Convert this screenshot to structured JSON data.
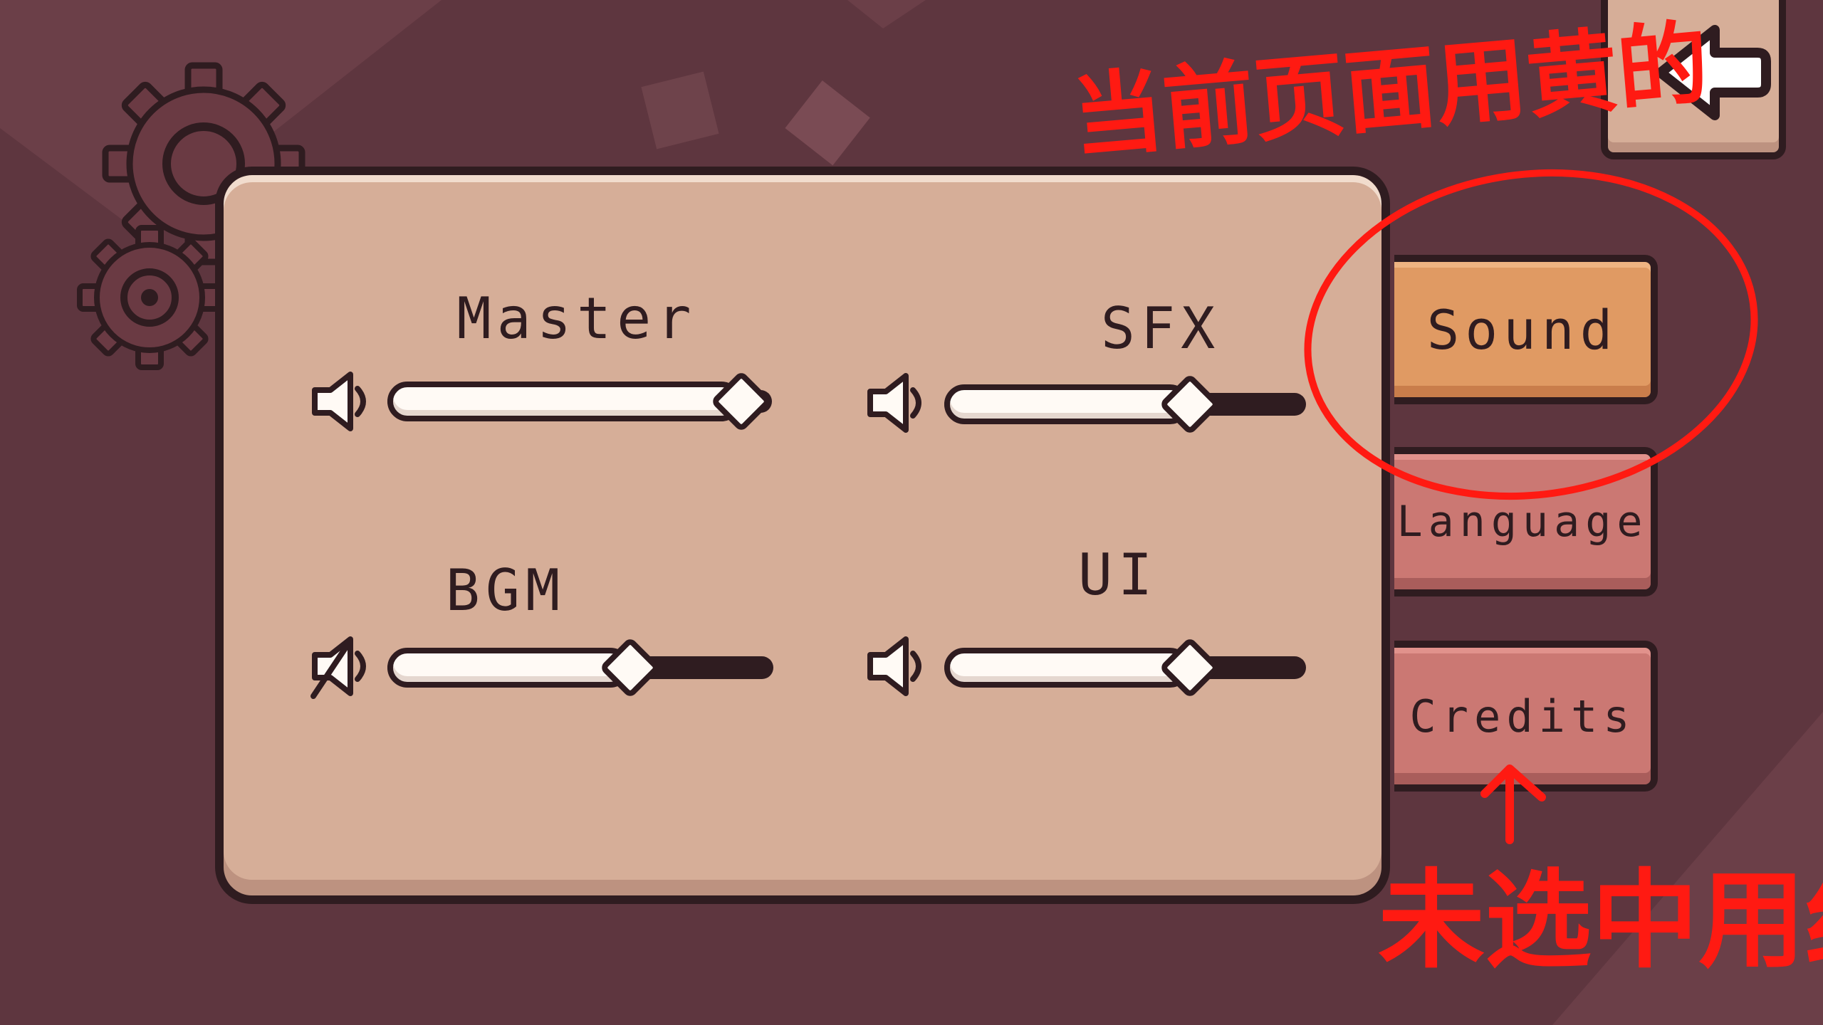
{
  "settings": {
    "sliders": [
      {
        "id": "master",
        "label": "Master",
        "value": 0.92,
        "muted": false
      },
      {
        "id": "sfx",
        "label": "SFX",
        "value": 0.68,
        "muted": false
      },
      {
        "id": "bgm",
        "label": "BGM",
        "value": 0.63,
        "muted": true
      },
      {
        "id": "ui",
        "label": "UI",
        "value": 0.68,
        "muted": false
      }
    ],
    "tabs": [
      {
        "id": "sound",
        "label": "Sound",
        "selected": true
      },
      {
        "id": "language",
        "label": "Language",
        "selected": false
      },
      {
        "id": "credits",
        "label": "Credits",
        "selected": false
      }
    ],
    "back_icon": "back-arrow-icon"
  },
  "annotations": {
    "selected_note": "当前页面用黄的",
    "unselected_note": "未选中用红"
  },
  "colors": {
    "background": "#5e363f",
    "panel": "#d6ae98",
    "outline": "#2f1c20",
    "tab_selected": "#e09a63",
    "tab_unselected": "#cb7873",
    "annotation_red": "#ff1a12"
  }
}
